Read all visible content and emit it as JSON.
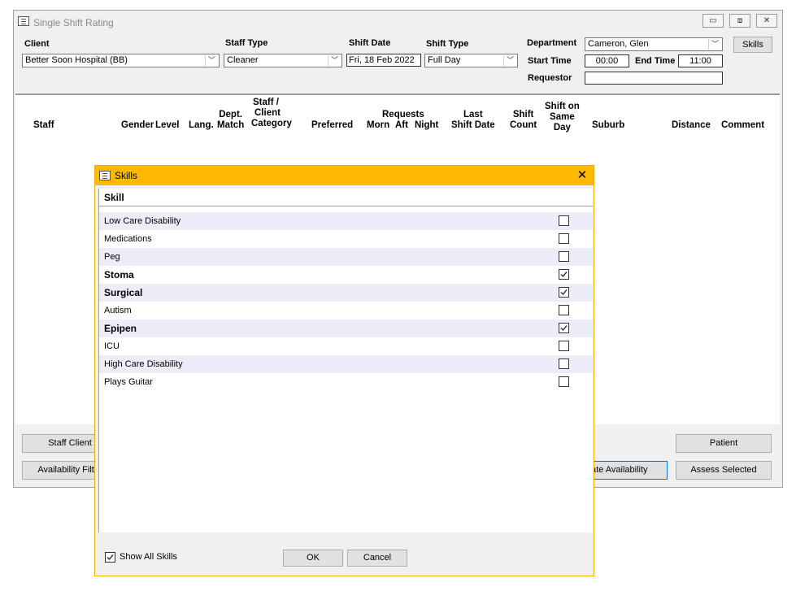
{
  "window": {
    "title": "Single Shift Rating",
    "controls": {
      "minimize": "▭",
      "maximize": "⧈",
      "close": "✕"
    }
  },
  "form": {
    "client": {
      "label": "Client",
      "value": "Better Soon Hospital   (BB)"
    },
    "staff_type": {
      "label": "Staff Type",
      "value": "Cleaner"
    },
    "shift_date": {
      "label": "Shift Date",
      "value": "Fri, 18 Feb 2022"
    },
    "shift_type": {
      "label": "Shift Type",
      "value": "Full Day"
    },
    "department": {
      "label": "Department",
      "value": "Cameron, Glen"
    },
    "start_time": {
      "label": "Start Time",
      "value": "00:00"
    },
    "end_time": {
      "label": "End Time",
      "value": "11:00"
    },
    "requestor": {
      "label": "Requestor",
      "value": ""
    },
    "skills_button": "Skills"
  },
  "grid": {
    "columns": {
      "staff": "Staff",
      "gender": "Gender",
      "level": "Level",
      "lang": "Lang.",
      "dept_match": [
        "Dept.",
        "Match"
      ],
      "staff_client_category": [
        "Staff /",
        "Client",
        "Category"
      ],
      "preferred": "Preferred",
      "requests": "Requests",
      "morn": "Morn",
      "aft": "Aft",
      "night": "Night",
      "last_shift_date": [
        "Last",
        "Shift Date"
      ],
      "shift_count": [
        "Shift",
        "Count"
      ],
      "shift_on_same_day": [
        "Shift on",
        "Same",
        "Day"
      ],
      "suburb": "Suburb",
      "distance": "Distance",
      "comment": "Comment"
    }
  },
  "bottom_buttons": {
    "staff_client": "Staff Client",
    "availability_filter": "Availability Filter",
    "update_availability": "ate Availability",
    "patient": "Patient",
    "assess_selected": "Assess Selected"
  },
  "skills_dialog": {
    "title": "Skills",
    "close": "✕",
    "column_header": "Skill",
    "items": [
      {
        "name": "Low Care Disability",
        "checked": false
      },
      {
        "name": "Medications",
        "checked": false
      },
      {
        "name": "Peg",
        "checked": false
      },
      {
        "name": "Stoma",
        "checked": true
      },
      {
        "name": "Surgical",
        "checked": true
      },
      {
        "name": "Autism",
        "checked": false
      },
      {
        "name": "Epipen",
        "checked": true
      },
      {
        "name": "ICU",
        "checked": false
      },
      {
        "name": "High Care Disability",
        "checked": false
      },
      {
        "name": "Plays Guitar",
        "checked": false
      }
    ],
    "show_all_skills": {
      "label": "Show All Skills",
      "checked": true
    },
    "ok": "OK",
    "cancel": "Cancel"
  },
  "colors": {
    "dialog_titlebar": "#ffb900",
    "row_alternate": "#ecedf8",
    "window_bg": "#f0f0f0"
  }
}
